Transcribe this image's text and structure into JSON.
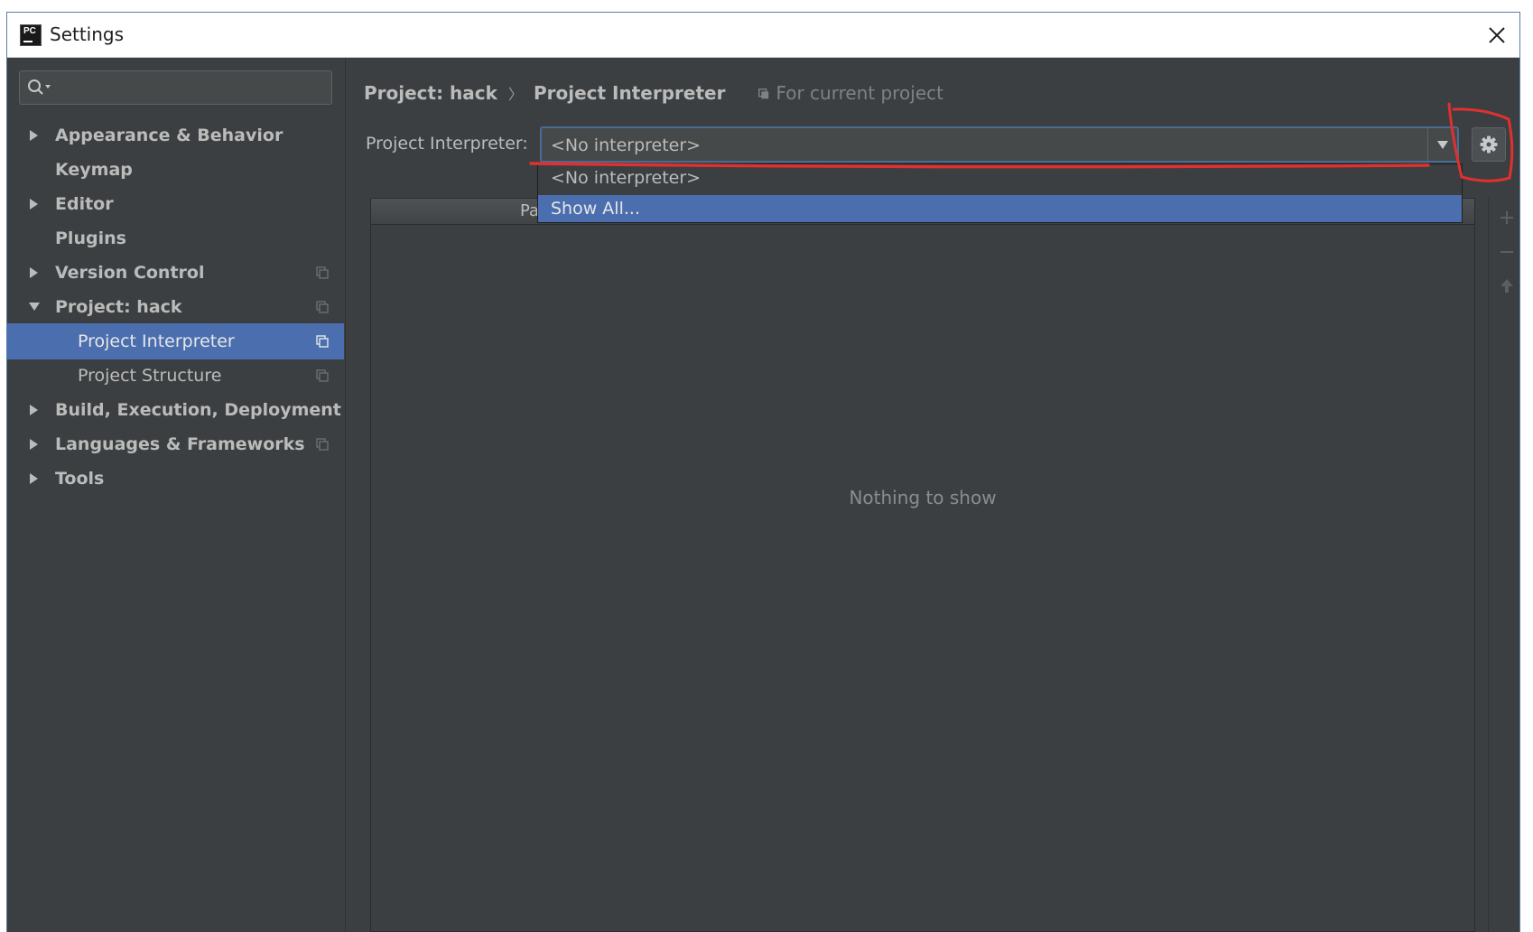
{
  "window": {
    "title": "Settings"
  },
  "sidebar": {
    "search_placeholder": "",
    "items": [
      {
        "label": "Appearance & Behavior"
      },
      {
        "label": "Keymap"
      },
      {
        "label": "Editor"
      },
      {
        "label": "Plugins"
      },
      {
        "label": "Version Control"
      },
      {
        "label": "Project: hack"
      },
      {
        "label": "Project Interpreter"
      },
      {
        "label": "Project Structure"
      },
      {
        "label": "Build, Execution, Deployment"
      },
      {
        "label": "Languages & Frameworks"
      },
      {
        "label": "Tools"
      }
    ]
  },
  "breadcrumb": {
    "parent": "Project: hack",
    "current": "Project Interpreter",
    "scope_note": "For current project"
  },
  "interpreter": {
    "label": "Project Interpreter:",
    "value": "<No interpreter>",
    "options": [
      "<No interpreter>",
      "Show All..."
    ],
    "highlighted_option": "Show All..."
  },
  "packages_table": {
    "column_visible": "Pa",
    "empty_text": "Nothing to show"
  },
  "icons": {
    "app": "pycharm-icon",
    "close": "close-icon",
    "search": "search-icon",
    "gear": "gear-icon",
    "add": "plus-icon",
    "remove": "minus-icon",
    "upgrade": "arrow-up-icon"
  },
  "colors": {
    "background": "#3c3f41",
    "selection": "#4b6eaf",
    "text": "#bbbbbb",
    "annotation": "#e03030"
  }
}
